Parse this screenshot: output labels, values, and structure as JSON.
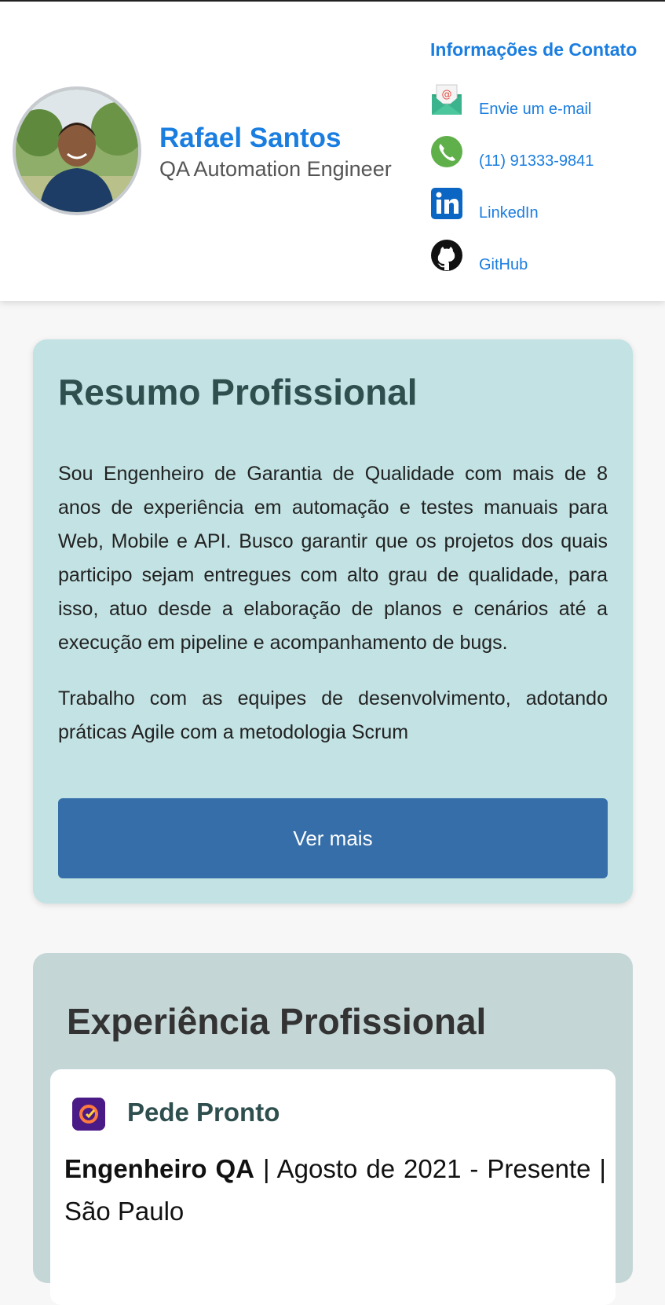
{
  "header": {
    "name": "Rafael Santos",
    "role": "QA Automation Engineer",
    "contact_title": "Informações de Contato",
    "contacts": [
      {
        "label": "Envie um e-mail",
        "icon": "email-icon"
      },
      {
        "label": "(11) 91333-9841",
        "icon": "phone-icon"
      },
      {
        "label": "LinkedIn",
        "icon": "linkedin-icon"
      },
      {
        "label": "GitHub",
        "icon": "github-icon"
      }
    ]
  },
  "resumo": {
    "title": "Resumo Profissional",
    "paragraphs": [
      "Sou Engenheiro de Garantia de Qualidade com mais de 8 anos de experiência em automação e testes manuais para Web, Mobile e API. Busco garantir que os projetos dos quais participo sejam entregues com alto grau de qualidade, para isso, atuo desde a elaboração de planos e cenários até a execução em pipeline e acompanhamento de bugs.",
      "Trabalho com as equipes de desenvolvimento, adotando práticas Agile com a metodologia Scrum"
    ],
    "button": "Ver mais"
  },
  "experiencia": {
    "title": "Experiência Profissional",
    "jobs": [
      {
        "company": "Pede Pronto",
        "position": "Engenheiro QA",
        "details": "| Agosto de 2021 - Presente | São Paulo"
      }
    ]
  },
  "colors": {
    "accent": "#1a7de0",
    "resumo_bg": "#c2e2e3",
    "button_bg": "#356ea8",
    "exp_bg": "#c5d6d6"
  }
}
